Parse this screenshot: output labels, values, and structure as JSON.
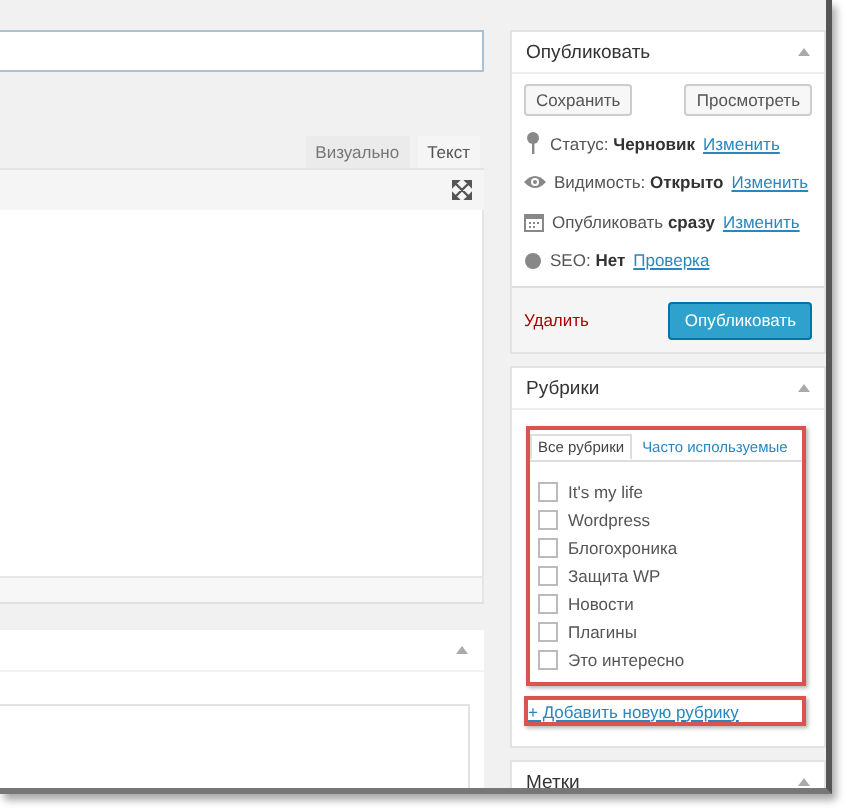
{
  "editor": {
    "tabs": [
      {
        "label": "Визуально",
        "selected": false
      },
      {
        "label": "Текст",
        "selected": true
      }
    ]
  },
  "publish": {
    "title": "Опубликовать",
    "save_button": "Сохранить",
    "preview_button": "Просмотреть",
    "rows": [
      {
        "kind": "pin",
        "text": "Статус: **Черновик**",
        "link": "Изменить"
      },
      {
        "kind": "eye",
        "text": "Видимость: **Открыто**",
        "link": "Изменить"
      },
      {
        "kind": "calendar",
        "text": "Опубликовать **сразу**",
        "link": "Изменить"
      },
      {
        "kind": "dot",
        "text": "SEO: **Нет**",
        "link": "Проверка"
      }
    ],
    "delete_link": "Удалить",
    "publish_button": "Опубликовать"
  },
  "categories": {
    "title": "Рубрики",
    "tabs": [
      {
        "label": "Все рубрики",
        "selected": true
      },
      {
        "label": "Часто используемые",
        "selected": false
      }
    ],
    "items": [
      {
        "label": "It's my life",
        "checked": false
      },
      {
        "label": "Wordpress",
        "checked": false
      },
      {
        "label": "Блогохроника",
        "checked": false
      },
      {
        "label": "Защита WP",
        "checked": false
      },
      {
        "label": "Новости",
        "checked": false
      },
      {
        "label": "Плагины",
        "checked": false
      },
      {
        "label": "Это интересно",
        "checked": false
      }
    ],
    "add_link": "+ Добавить новую рубрику"
  },
  "tags": {
    "title": "Метки"
  }
}
